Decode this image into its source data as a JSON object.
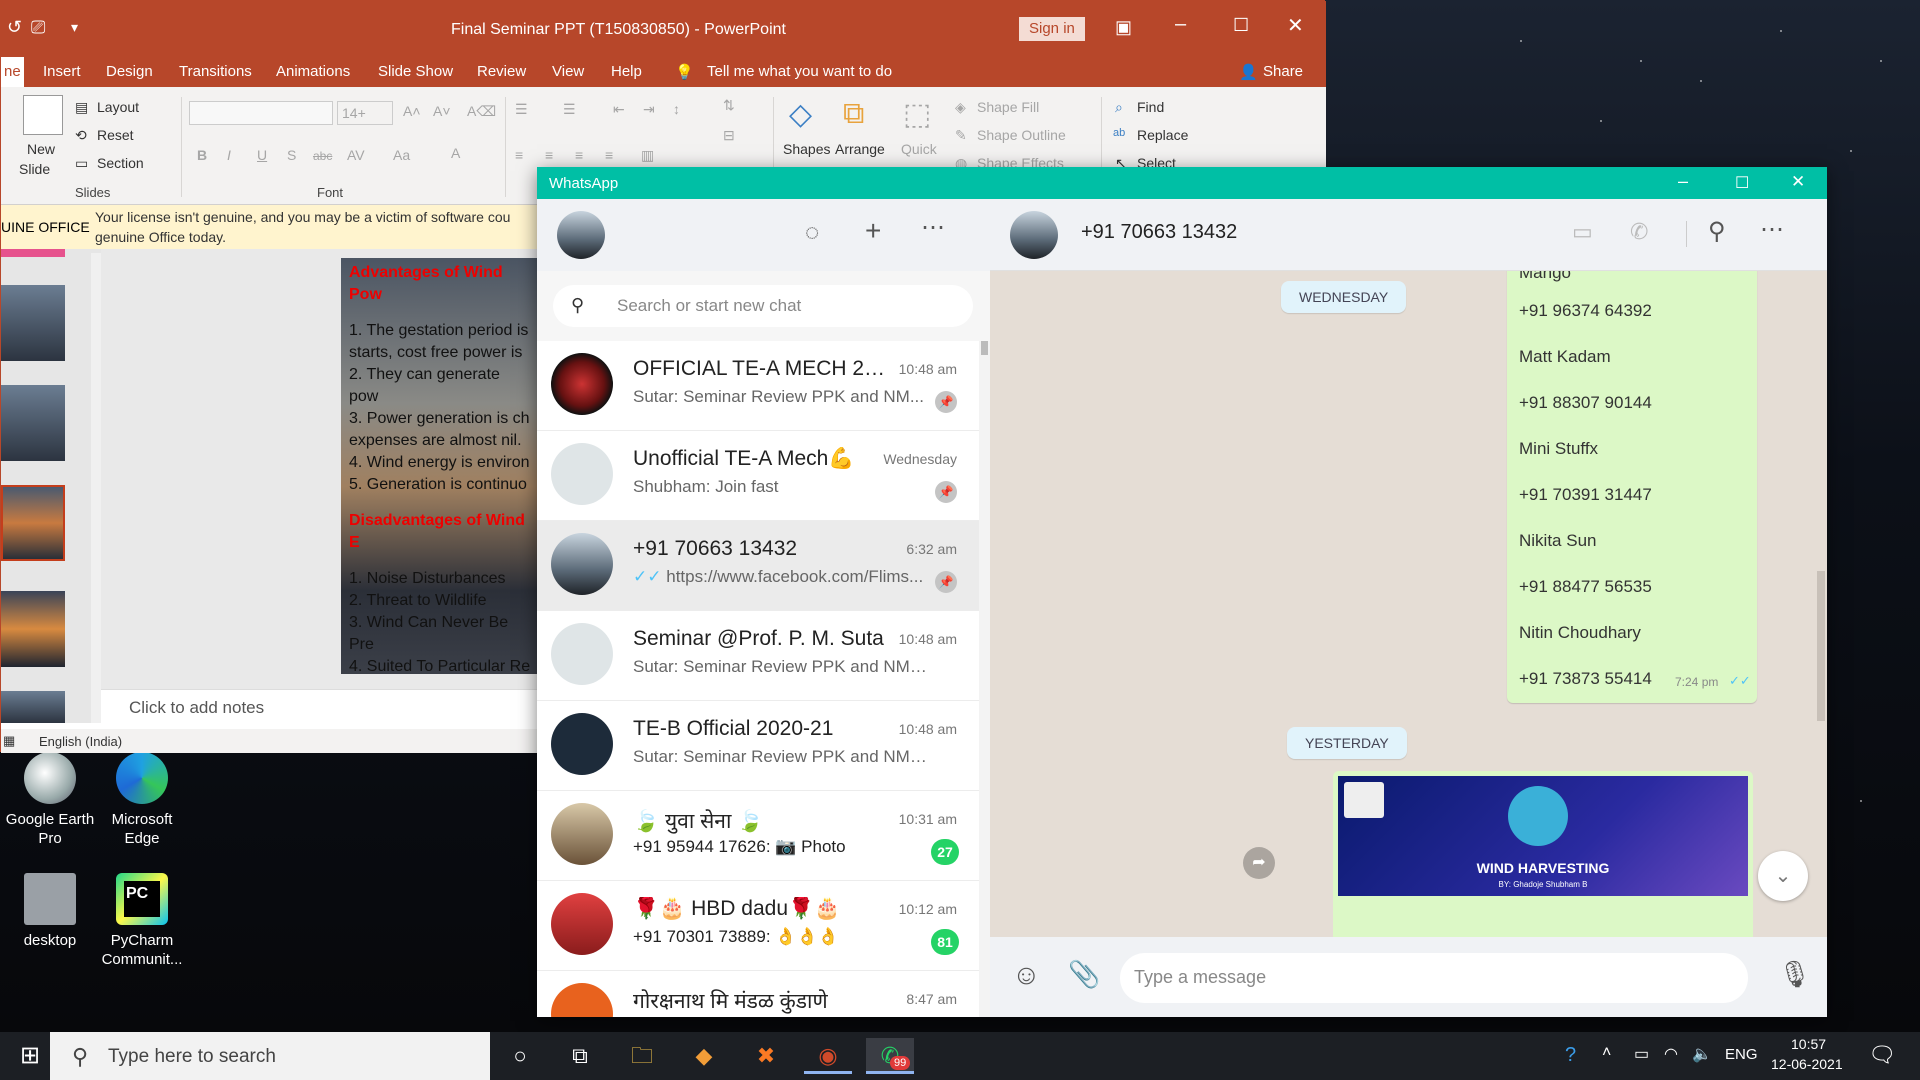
{
  "powerpoint": {
    "title": "Final Seminar PPT (T150830850)  -  PowerPoint",
    "sign_in": "Sign in",
    "tabs": [
      "ne",
      "Insert",
      "Design",
      "Transitions",
      "Animations",
      "Slide Show",
      "Review",
      "View",
      "Help"
    ],
    "tell_me": "Tell me what you want to do",
    "share": "Share",
    "ribbon": {
      "new_slide": "New",
      "new_slide2": "Slide",
      "layout": "Layout",
      "reset": "Reset",
      "section": "Section",
      "slides_group": "Slides",
      "font_size": "14+",
      "font_group": "Font",
      "bold": "B",
      "italic": "I",
      "underline": "U",
      "shadow": "S",
      "strike": "abc",
      "shapes": "Shapes",
      "arrange": "Arrange",
      "quick": "Quick",
      "shape_fill": "Shape Fill",
      "shape_outline": "Shape Outline",
      "shape_effects": "Shape Effects",
      "find": "Find",
      "replace": "Replace",
      "select": "Select"
    },
    "license_label": "UINE OFFICE",
    "license_text1": "Your license isn't genuine, and you may be a victim of software cou",
    "license_text2": "genuine Office today.",
    "slide": {
      "heading1": "Advantages of Wind Pow",
      "points_adv": [
        "1. The gestation period is",
        "starts, cost free power is",
        "2. They can generate pow",
        "3. Power generation is ch",
        "expenses are almost nil.",
        "4. Wind energy is environ",
        "5. Generation is continuo"
      ],
      "heading2": "Disadvantages of Wind E",
      "points_dis": [
        "1. Noise Disturbances",
        "2. Threat to Wildlife",
        "3. Wind Can Never Be Pre",
        "4. Suited To Particular Re"
      ]
    },
    "notes_placeholder": "Click to add notes",
    "language": "English (India)"
  },
  "desktop_icons": [
    {
      "label": "Google Earth Pro",
      "line1": "Google Earth",
      "line2": "Pro"
    },
    {
      "label": "Microsoft Edge",
      "line1": "Microsoft",
      "line2": "Edge"
    },
    {
      "label": "desktop",
      "line1": "desktop",
      "line2": ""
    },
    {
      "label": "PyCharm Communit...",
      "line1": "PyCharm",
      "line2": "Communit..."
    }
  ],
  "whatsapp": {
    "title": "WhatsApp",
    "search_placeholder": "Search or start new chat",
    "chats": [
      {
        "name": "OFFICIAL TE-A MECH 20-...",
        "time": "10:48 am",
        "message": "Sutar: Seminar Review PPK and NM...",
        "pinned": true,
        "badge": ""
      },
      {
        "name": "Unofficial TE-A Mech💪",
        "time": "Wednesday",
        "message": "Shubham: Join fast",
        "pinned": true,
        "badge": ""
      },
      {
        "name": "+91 70663 13432",
        "time": "6:32 am",
        "message": "https://www.facebook.com/Flims...",
        "pinned": true,
        "badge": ""
      },
      {
        "name": "Seminar @Prof. P. M. Suta",
        "time": "10:48 am",
        "message": "Sutar: Seminar Review PPK and NMO S...",
        "pinned": false,
        "badge": ""
      },
      {
        "name": "TE-B Official 2020-21",
        "time": "10:48 am",
        "message": "Sutar: Seminar Review PPK and NMO S...",
        "pinned": false,
        "badge": ""
      },
      {
        "name": "🍃 युवा सेना 🍃",
        "time": "10:31 am",
        "message": "+91 95944 17626: 📷 Photo",
        "pinned": false,
        "badge": "27"
      },
      {
        "name": "🌹🎂 HBD dadu🌹🎂",
        "time": "10:12 am",
        "message": "+91 70301 73889: 👌👌👌",
        "pinned": false,
        "badge": "81"
      },
      {
        "name": "गोरक्षनाथ मि मंडळ कुंडाणे",
        "time": "8:47 am",
        "message": "",
        "pinned": false,
        "badge": ""
      }
    ],
    "active_chat": "+91 70663 13432",
    "day_wednesday": "WEDNESDAY",
    "day_yesterday": "YESTERDAY",
    "contact_lines": [
      "Mango",
      "+91 96374 64392",
      "Matt Kadam",
      "+91 88307 90144",
      "Mini Stuffx",
      "+91 70391 31447",
      "Nikita Sun",
      "+91 88477 56535",
      "Nitin Choudhary",
      "+91 73873 55414"
    ],
    "bubble_time": "7:24 pm",
    "image_caption": "WIND HARVESTING",
    "image_sub": "BY: Ghadoje Shubham B",
    "message_placeholder": "Type a message"
  },
  "taskbar": {
    "search_placeholder": "Type here to search",
    "whatsapp_badge": "99",
    "language": "ENG",
    "time": "10:57",
    "date": "12-06-2021"
  },
  "colors": {
    "ppt_accent": "#b7472a",
    "whatsapp_teal": "#00bfa5",
    "whatsapp_green": "#25d366",
    "bubble_green": "#dcf8c6"
  }
}
